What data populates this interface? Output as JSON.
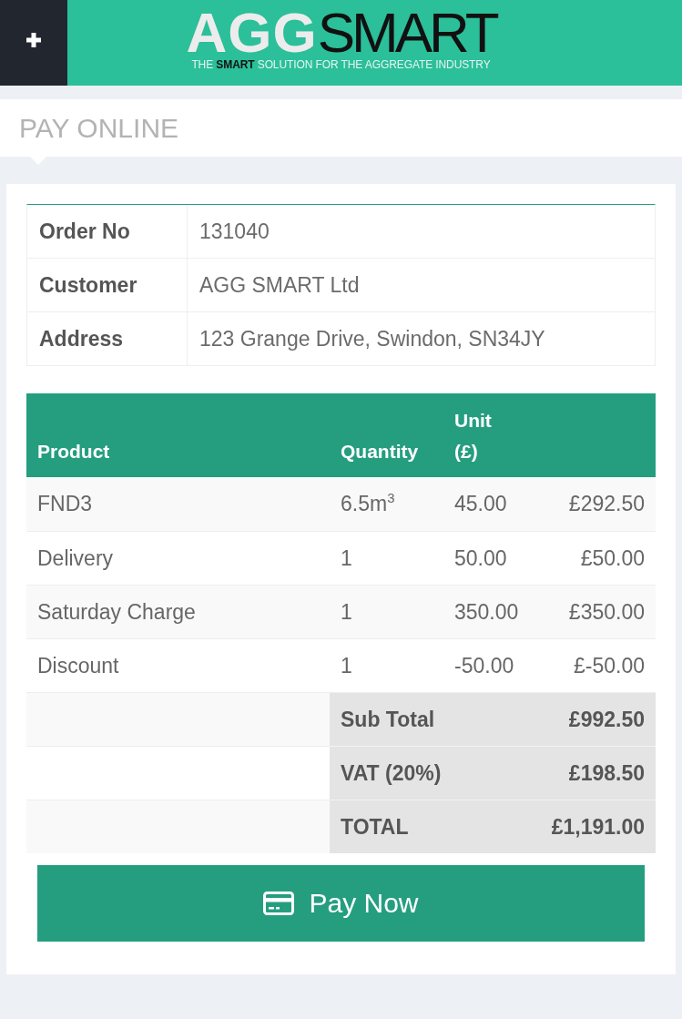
{
  "header": {
    "logo": {
      "wordmark": "**AGG**SMART",
      "tagline": "THE **SMART** SOLUTION FOR THE AGGREGATE INDUSTRY"
    }
  },
  "page_title": "PAY ONLINE",
  "order_info": [
    {
      "label": "Order No",
      "value": "131040"
    },
    {
      "label": "Customer",
      "value": "AGG SMART Ltd"
    },
    {
      "label": "Address",
      "value": "123 Grange Drive, Swindon, SN34JY"
    }
  ],
  "items": {
    "columns": [
      "Product",
      "Quantity",
      "Unit (£)"
    ],
    "rows": [
      [
        "FND3",
        "6.5m$^{3}$",
        "45.00",
        "£292.50"
      ],
      [
        "Delivery",
        "1",
        "50.00",
        "£50.00"
      ],
      [
        "Saturday Charge",
        "1",
        "350.00",
        "£350.00"
      ],
      [
        "Discount",
        "1",
        "-50.00",
        "£-50.00"
      ]
    ],
    "summary": [
      {
        "label": "Sub Total",
        "value": "£992.50"
      },
      {
        "label": "VAT (20%)",
        "value": "£198.50"
      },
      {
        "label": "TOTAL",
        "value": "£1,191.00"
      }
    ]
  },
  "pay_button": {
    "label": "Pay Now"
  }
}
